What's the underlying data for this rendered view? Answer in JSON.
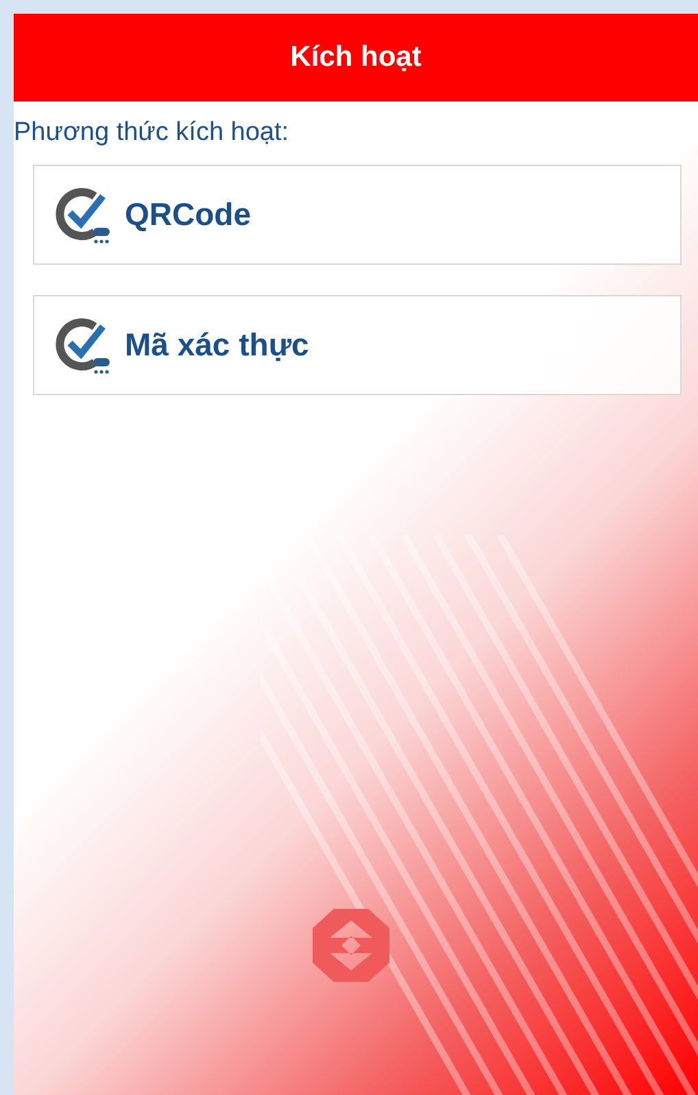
{
  "header": {
    "title": "Kích hoạt"
  },
  "section_label": "Phương thức kích hoạt:",
  "methods": [
    {
      "label": "QRCode"
    },
    {
      "label": "Mã xác thực"
    }
  ]
}
